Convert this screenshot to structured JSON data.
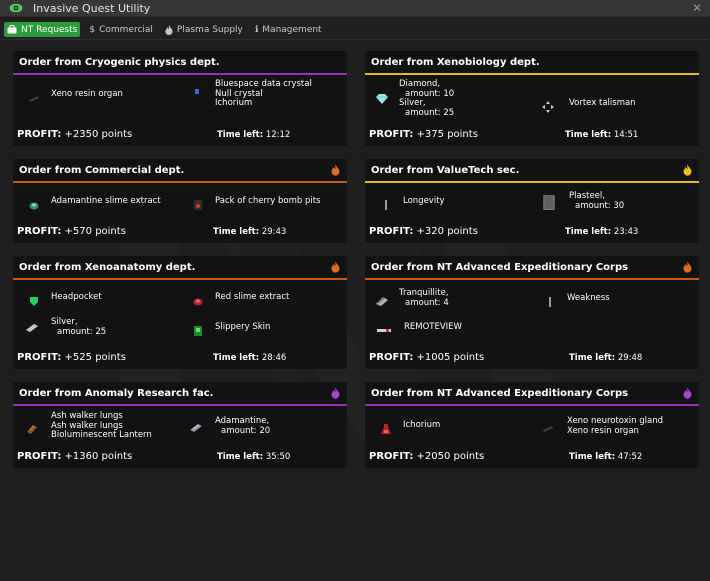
{
  "window": {
    "title": "Invasive Quest Utility",
    "close": "✕"
  },
  "tabs": [
    {
      "icon": "briefcase-icon",
      "label": "NT Requests",
      "active": true
    },
    {
      "icon": "dollar-icon",
      "label": "Commercial",
      "active": false
    },
    {
      "icon": "flame-icon",
      "label": "Plasma Supply",
      "active": false
    },
    {
      "icon": "info-icon",
      "label": "Management",
      "active": false
    }
  ],
  "labels": {
    "profit": "PROFIT:",
    "time_left": "Time left:"
  },
  "orders": [
    {
      "title": "Order from Cryogenic physics dept.",
      "accent": "#9b2bbd",
      "flame": null,
      "items": [
        {
          "lines": [
            "Xeno resin organ"
          ],
          "icon": "resin-organ-icon"
        },
        {
          "lines": [
            "Bluespace data crystal",
            "Null crystal",
            "Ichorium"
          ],
          "icon": "blue-crystal-icon"
        }
      ],
      "profit": "+2350 points",
      "time_left": "12:12"
    },
    {
      "title": "Order from Xenobiology dept.",
      "accent": "#e0c400",
      "flame": null,
      "items": [
        {
          "lines": [
            "Diamond,",
            "amount: 10",
            "Silver,",
            "amount: 25"
          ],
          "icon": "diamond-icon"
        },
        {
          "lines": [
            "Vortex talisman"
          ],
          "icon": "talisman-icon"
        }
      ],
      "profit": "+375 points",
      "time_left": "14:51"
    },
    {
      "title": "Order from Commercial dept.",
      "accent": "#d05a14",
      "flame": "#e86b1c",
      "items": [
        {
          "lines": [
            "Adamantine slime extract"
          ],
          "icon": "slime-extract-icon"
        },
        {
          "lines": [
            "Pack of cherry bomb pits"
          ],
          "icon": "seed-pack-icon"
        }
      ],
      "profit": "+570 points",
      "time_left": "29:43"
    },
    {
      "title": "Order from ValueTech sec.",
      "accent": "#e0c400",
      "flame": "#f1c40f",
      "items": [
        {
          "lines": [
            "Longevity"
          ],
          "icon": "syringe-icon"
        },
        {
          "lines": [
            "Plasteel,",
            "amount: 30"
          ],
          "icon": "plasteel-icon"
        }
      ],
      "profit": "+320 points",
      "time_left": "23:43"
    },
    {
      "title": "Order from Xenoanatomy dept.",
      "accent": "#d05a14",
      "flame": "#e86b1c",
      "items": [
        {
          "lines": [
            "Headpocket"
          ],
          "icon": "headpocket-icon"
        },
        {
          "lines": [
            "Red slime extract"
          ],
          "icon": "red-slime-icon"
        },
        {
          "lines": [
            "Silver,",
            "amount: 25"
          ],
          "icon": "silver-icon"
        },
        {
          "lines": [
            "Slippery Skin"
          ],
          "icon": "slippery-skin-icon"
        }
      ],
      "profit": "+525 points",
      "time_left": "28:46"
    },
    {
      "title": "Order from NT Advanced Expeditionary Corps",
      "accent": "#d05a14",
      "flame": "#e86b1c",
      "items": [
        {
          "lines": [
            "Tranquillite,",
            "amount: 4"
          ],
          "icon": "tranquillite-icon"
        },
        {
          "lines": [
            "Weakness"
          ],
          "icon": "syringe-icon"
        },
        {
          "lines": [
            "REMOTEVIEW"
          ],
          "icon": "dna-injector-icon"
        }
      ],
      "profit": "+1005 points",
      "time_left": "29:48"
    },
    {
      "title": "Order from Anomaly Research fac.",
      "accent": "#9b2bbd",
      "flame": "#b03fe0",
      "items": [
        {
          "lines": [
            "Ash walker lungs",
            "Ash walker lungs",
            "Bioluminescent Lantern"
          ],
          "icon": "lungs-icon"
        },
        {
          "lines": [
            "Adamantine,",
            "amount: 20"
          ],
          "icon": "adamantine-icon"
        }
      ],
      "profit": "+1360 points",
      "time_left": "35:50"
    },
    {
      "title": "Order from NT Advanced Expeditionary Corps",
      "accent": "#9b2bbd",
      "flame": "#b03fe0",
      "items": [
        {
          "lines": [
            "Ichorium"
          ],
          "icon": "ichorium-icon"
        },
        {
          "lines": [
            "Xeno neurotoxin gland",
            "Xeno resin organ"
          ],
          "icon": "neurotoxin-gland-icon"
        }
      ],
      "profit": "+2050 points",
      "time_left": "47:52"
    }
  ]
}
